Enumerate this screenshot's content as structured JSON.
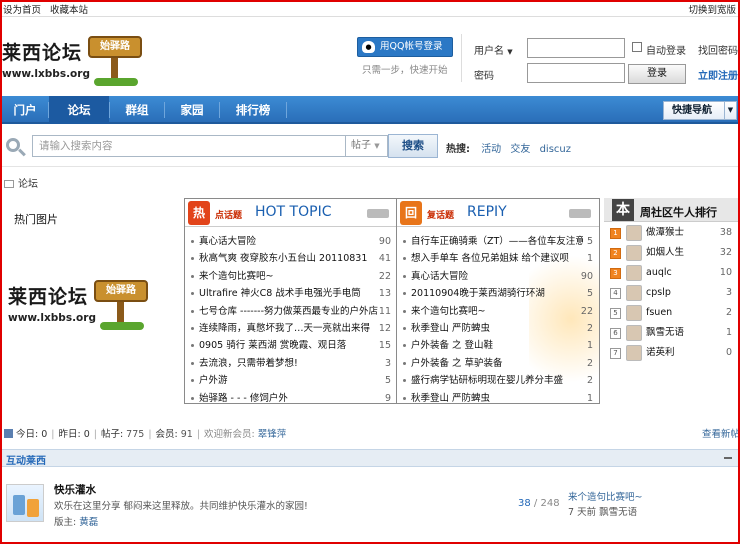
{
  "topbar": {
    "set_home": "设为首页",
    "bookmark": "收藏本站",
    "switch_width": "切换到宽版"
  },
  "logo": {
    "text": "莱西论坛",
    "url": "www.lxbbs.org",
    "sign": "始驿路"
  },
  "login": {
    "qq_button": "用QQ帐号登录",
    "qq_tip": "只需一步，快速开始",
    "username_label": "用户名",
    "password_label": "密码",
    "auto_login": "自动登录",
    "find_password": "找回密码",
    "login_button": "登录",
    "register": "立即注册"
  },
  "nav": {
    "items": [
      "门户",
      "论坛",
      "群组",
      "家园",
      "排行榜"
    ],
    "active": 1,
    "quick_nav": "快捷导航"
  },
  "search": {
    "placeholder": "请输入搜索内容",
    "type": "帖子",
    "button": "搜索",
    "hot_label": "热搜:",
    "hot": [
      "活动",
      "交友",
      "discuz"
    ]
  },
  "breadcrumb": {
    "current": "论坛"
  },
  "hot_pics": {
    "title": "热门图片"
  },
  "hot_topic": {
    "badge": "热",
    "tag": "点话题",
    "title": "HOT TOPIC",
    "rows": [
      {
        "t": "真心话大冒险",
        "n": "90"
      },
      {
        "t": "秋高气爽 夜穿胶东小五台山 20110831",
        "n": "41"
      },
      {
        "t": "来个造句比赛吧~",
        "n": "22"
      },
      {
        "t": "Ultrafire 神火C8 战术手电强光手电筒",
        "n": "13"
      },
      {
        "t": "七号仓库 -------努力做莱西最专业的户外店",
        "n": "11"
      },
      {
        "t": "连续降雨，真憋坏我了…天一亮就出来得",
        "n": "12"
      },
      {
        "t": "0905 骑行 莱西湖 赏晚霞、观日落",
        "n": "15"
      },
      {
        "t": "去流浪，只需带着梦想!",
        "n": "3"
      },
      {
        "t": "户外游",
        "n": "5"
      },
      {
        "t": "始驿路 - - - 修饲户外",
        "n": "9"
      }
    ]
  },
  "reply": {
    "badge": "回",
    "tag": "复话题",
    "title": "REPIY",
    "rows": [
      {
        "t": "自行车正确骑乘（ZT）——各位车友注意",
        "n": "5"
      },
      {
        "t": "想入手单车 各位兄弟姐妹 给个建议呗",
        "n": "1"
      },
      {
        "t": "真心话大冒险",
        "n": "90"
      },
      {
        "t": "20110904晚于莱西湖骑行环湖",
        "n": "5"
      },
      {
        "t": "来个造句比赛吧~",
        "n": "22"
      },
      {
        "t": "秋季登山 严防蜱虫",
        "n": "2"
      },
      {
        "t": "户外装备 之 登山鞋",
        "n": "1"
      },
      {
        "t": "户外装备 之 草驴装备",
        "n": "2"
      },
      {
        "t": "盛行病学钻研标明现在婴儿养分丰盛",
        "n": "2"
      },
      {
        "t": "秋季登山 严防蜱虫",
        "n": "1"
      }
    ]
  },
  "rank": {
    "badge": "本",
    "title": "周社区牛人排行",
    "rows": [
      {
        "no": "1",
        "name": "做潭猴士",
        "score": "38"
      },
      {
        "no": "2",
        "name": "如烟人生",
        "score": "32"
      },
      {
        "no": "3",
        "name": "auqlc",
        "score": "10"
      },
      {
        "no": "4",
        "name": "cpslp",
        "score": "3"
      },
      {
        "no": "5",
        "name": "fsuen",
        "score": "2"
      },
      {
        "no": "6",
        "name": "飘雪无语",
        "score": "1"
      },
      {
        "no": "7",
        "name": "诺英利",
        "score": "0"
      }
    ]
  },
  "stats": {
    "today": "今日: 0",
    "yesterday": "昨日: 0",
    "posts_label": "帖子:",
    "posts": "775",
    "members_label": "会员:",
    "members": "91",
    "welcome": "欢迎新会员:",
    "new_member": "翠锋萍",
    "view_new": "查看新帖"
  },
  "group": {
    "title": "互动莱西"
  },
  "forum": {
    "title": "快乐灌水",
    "desc": "欢乐在这里分享 郁闷来这里释放。共同维护快乐灌水的家园!",
    "mod_label": "版主:",
    "mod": "黄磊",
    "threads": "38",
    "posts": "248",
    "last_title": "来个造句比赛吧~",
    "last_time": "7 天前",
    "last_user": "飘雪无语"
  }
}
